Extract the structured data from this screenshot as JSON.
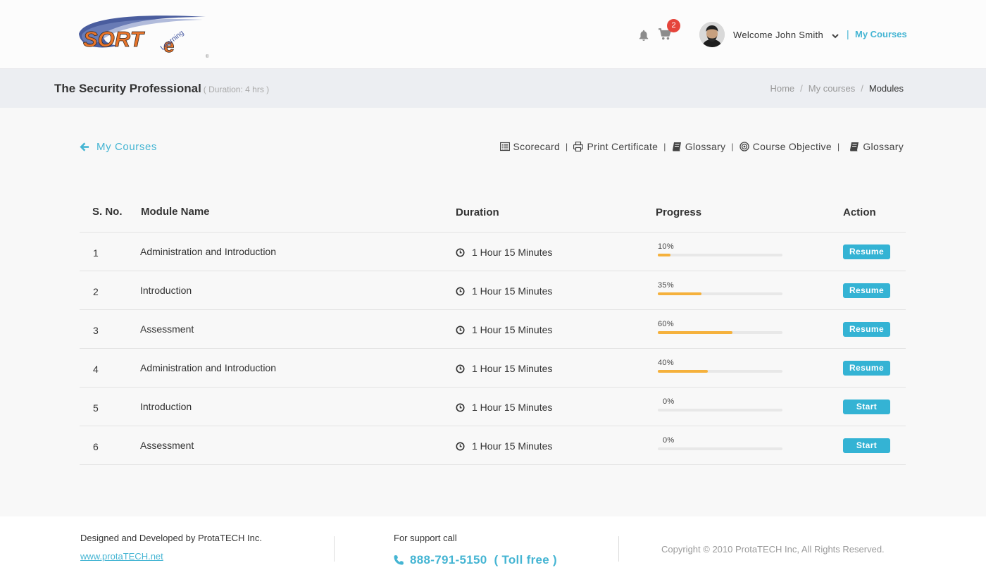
{
  "header": {
    "logo": {
      "text_sort": "SORT",
      "text_e": "e",
      "text_learning": "Learning",
      "mark": "©"
    },
    "notifications_icon": "bell-icon",
    "cart_icon": "cart-icon",
    "cart_count": "2",
    "welcome_text": "Welcome John Smith",
    "separator": "|",
    "my_courses_link": "My Courses"
  },
  "title_bar": {
    "title": "The Security Professional",
    "duration_note": "( Duration: 4 hrs )",
    "breadcrumb": [
      "Home",
      "My courses",
      "Modules"
    ],
    "breadcrumb_separator": "/"
  },
  "subnav": {
    "back_label": "My Courses",
    "tools": [
      {
        "label": "Scorecard",
        "icon": "list-icon"
      },
      {
        "label": "Print Certificate",
        "icon": "print-icon"
      },
      {
        "label": "Glossary",
        "icon": "book-icon"
      },
      {
        "label": "Course Objective",
        "icon": "target-icon"
      },
      {
        "label": "Glossary",
        "icon": "book-icon"
      }
    ],
    "pipe": "|"
  },
  "table": {
    "headers": {
      "sno": "S. No.",
      "name": "Module Name",
      "duration": "Duration",
      "progress": "Progress",
      "action": "Action"
    },
    "rows": [
      {
        "sno": "1",
        "name": "Administration and Introduction",
        "duration": "1 Hour 15 Minutes",
        "progress_label": "10%",
        "progress": 10,
        "action": "Resume"
      },
      {
        "sno": "2",
        "name": "Introduction",
        "duration": "1 Hour 15 Minutes",
        "progress_label": "35%",
        "progress": 35,
        "action": "Resume"
      },
      {
        "sno": "3",
        "name": "Assessment",
        "duration": "1 Hour 15 Minutes",
        "progress_label": "60%",
        "progress": 60,
        "action": "Resume"
      },
      {
        "sno": "4",
        "name": "Administration and Introduction",
        "duration": "1 Hour 15 Minutes",
        "progress_label": "40%",
        "progress": 40,
        "action": "Resume"
      },
      {
        "sno": "5",
        "name": "Introduction",
        "duration": "1 Hour 15 Minutes",
        "progress_label": "0%",
        "progress": 0,
        "action": "Start"
      },
      {
        "sno": "6",
        "name": "Assessment",
        "duration": "1 Hour 15 Minutes",
        "progress_label": "0%",
        "progress": 0,
        "action": "Start"
      }
    ]
  },
  "footer": {
    "designed_by": "Designed and Developed by ProtaTECH Inc.",
    "website": "www.protaTECH.net",
    "support_label": "For support call",
    "phone": "888-791-5150",
    "toll_free": "( Toll free )",
    "copyright": "Copyright © 2010 ProtaTECH Inc, All Rights Reserved."
  },
  "colors": {
    "accent": "#45b5d3",
    "button": "#34b3d4",
    "progress_fill": "#f5b13c",
    "badge": "#e5443b",
    "logo_orange": "#e8742a",
    "logo_blue": "#3a4e9b"
  }
}
